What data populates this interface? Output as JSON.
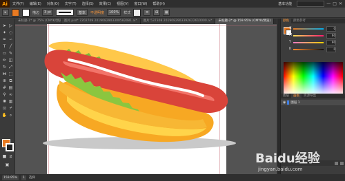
{
  "menubar": {
    "app_logo": "Ai",
    "items": [
      "文件(F)",
      "编辑(E)",
      "对象(O)",
      "文字(T)",
      "选择(S)",
      "效果(C)",
      "视图(V)",
      "窗口(W)",
      "帮助(H)"
    ],
    "workspace_label": "基本功能"
  },
  "controlbar": {
    "fill_color": "#e87a22",
    "stroke_color": "#ffffff",
    "stroke_label": "描边",
    "stroke_value": "3 pt",
    "brush_label": "基本",
    "opacity_label": "不透明度",
    "style_label": "样式"
  },
  "tabs": [
    {
      "label": "未标题-1* @ 75% (CMYK/预览)",
      "active": false
    },
    {
      "label": "图片.psd* 7202709 2019082903300582081.ai*",
      "active": false
    },
    {
      "label": "图片 537308 2019082903392622610000.ai*",
      "active": false
    },
    {
      "label": "未标题-2* @ 159.95% (CMYK/预览)",
      "active": true
    }
  ],
  "color_panel": {
    "tabs": [
      "颜色",
      "颜色参考"
    ],
    "sliders": [
      {
        "letter": "C",
        "value": "0",
        "track": "linear-gradient(to right,#e87a22,#00aeef)"
      },
      {
        "letter": "M",
        "value": "60",
        "track": "linear-gradient(to right,#ffe15a,#ff1a6e)"
      },
      {
        "letter": "Y",
        "value": "90",
        "track": "linear-gradient(to right,#ff7ac4,#ffd200)"
      },
      {
        "letter": "K",
        "value": "0",
        "track": "linear-gradient(to right,#ff8a2c,#111)"
      }
    ]
  },
  "layers_panel": {
    "tabs": [
      "图层",
      "画板",
      "资源导出"
    ],
    "layer_name": "图层 1"
  },
  "statusbar": {
    "zoom": "159.95%",
    "page": "1",
    "status": "选择"
  },
  "watermark": {
    "brand": "Baidu经验",
    "url": "jingyan.baidu.com"
  },
  "colors": {
    "accent": "#ff9a00",
    "bun": "#f7b734",
    "bun_light": "#ffd94a",
    "sausage": "#d9443a",
    "lettuce": "#7cb93a",
    "shadow": "#c9c9c9"
  }
}
